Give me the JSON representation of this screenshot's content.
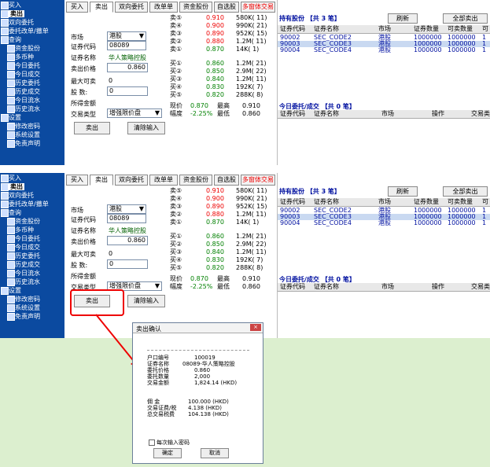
{
  "sidebar": {
    "items": [
      {
        "label": "买入"
      },
      {
        "label": "卖出"
      },
      {
        "label": "双向委托"
      },
      {
        "label": "委托改单/撤单"
      },
      {
        "label": "查询"
      },
      {
        "label": "资金股份"
      },
      {
        "label": "多币种"
      },
      {
        "label": "今日委托"
      },
      {
        "label": "今日成交"
      },
      {
        "label": "历史委托"
      },
      {
        "label": "历史成交"
      },
      {
        "label": "今日流水"
      },
      {
        "label": "历史流水"
      },
      {
        "label": "设置"
      },
      {
        "label": "修改密码"
      },
      {
        "label": "系统设置"
      },
      {
        "label": "免责声明"
      }
    ]
  },
  "tabs": [
    "买入",
    "卖出",
    "双向委托",
    "改单单",
    "资金股份",
    "自选股",
    "多窗体交易"
  ],
  "form": {
    "market_label": "市场",
    "market_value": "港股",
    "code_label": "证券代码",
    "code_value": "08089",
    "name_label": "证券名称",
    "name_value": "华人策略控股",
    "price_label": "卖出价格",
    "price_value": "0.860",
    "max_label": "最大可卖",
    "max_value": "0",
    "qty_label": "股 数:",
    "qty_value": "0",
    "amount_label": "所得金额",
    "type_label": "交易类型",
    "type_value": "增强限价盘",
    "sell_button": "卖出",
    "clear_button": "清除输入"
  },
  "quote": {
    "sell": [
      {
        "label": "卖⑤",
        "price": "0.910",
        "vol": "580K( 11)"
      },
      {
        "label": "卖④",
        "price": "0.900",
        "vol": "990K( 21)"
      },
      {
        "label": "卖③",
        "price": "0.890",
        "vol": "952K( 15)"
      },
      {
        "label": "卖②",
        "price": "0.880",
        "vol": "1.2M( 11)"
      },
      {
        "label": "卖①",
        "price": "0.870",
        "vol": "14K( 1)"
      }
    ],
    "buy": [
      {
        "label": "买①",
        "price": "0.860",
        "vol": "1.2M( 21)"
      },
      {
        "label": "买②",
        "price": "0.850",
        "vol": "2.9M( 22)"
      },
      {
        "label": "买③",
        "price": "0.840",
        "vol": "1.2M( 11)"
      },
      {
        "label": "买④",
        "price": "0.830",
        "vol": "192K( 7)"
      },
      {
        "label": "买⑤",
        "price": "0.820",
        "vol": "288K( 8)"
      }
    ],
    "last_label": "现价",
    "last_value": "0.870",
    "high_label": "最高",
    "high_value": "0.910",
    "change_label": "幅度",
    "change_value": "-2.25%",
    "low_label": "最低",
    "low_value": "0.860"
  },
  "holdings": {
    "title": "持有股份 【共 3 笔】",
    "refresh": "刷新",
    "sell_all": "全部卖出",
    "columns": [
      "证券代码",
      "证券名称",
      "市场",
      "证券数量",
      "可卖数量",
      "可"
    ],
    "rows": [
      [
        "90002",
        "SEC_CODE2",
        "港股",
        "1000000",
        "1000000",
        "1"
      ],
      [
        "90003",
        "SEC_CODE3",
        "港股",
        "1000000",
        "1000000",
        "1"
      ],
      [
        "90004",
        "SEC_CODE4",
        "港股",
        "1000000",
        "1000000",
        "1"
      ]
    ]
  },
  "orders": {
    "title": "今日委托/成交 【共 0 笔】",
    "columns": [
      "证券代码",
      "证券名称",
      "市场",
      "操作",
      "交易类"
    ]
  },
  "dialog": {
    "title": "卖出确认",
    "lines": [
      [
        "户口编号",
        "100019"
      ],
      [
        "证券名称",
        "08089-华人策略控股"
      ],
      [
        "委托价格",
        "0.860"
      ],
      [
        "委托数量",
        "2,000"
      ],
      [
        "交易金额",
        "1,824.14 (HKD)"
      ],
      [
        "佣 金",
        "100.000 (HKD)"
      ],
      [
        "交易证费/税",
        "4.138 (HKD)"
      ],
      [
        "总交易税费",
        "104.138 (HKD)"
      ]
    ],
    "checkbox": "每次输入密码",
    "ok": "确定",
    "cancel": "取消"
  },
  "colors": {
    "sidebar": "#0b4aa0",
    "bottom": "#dcefcf",
    "red": "#e00000",
    "green": "#008000"
  }
}
